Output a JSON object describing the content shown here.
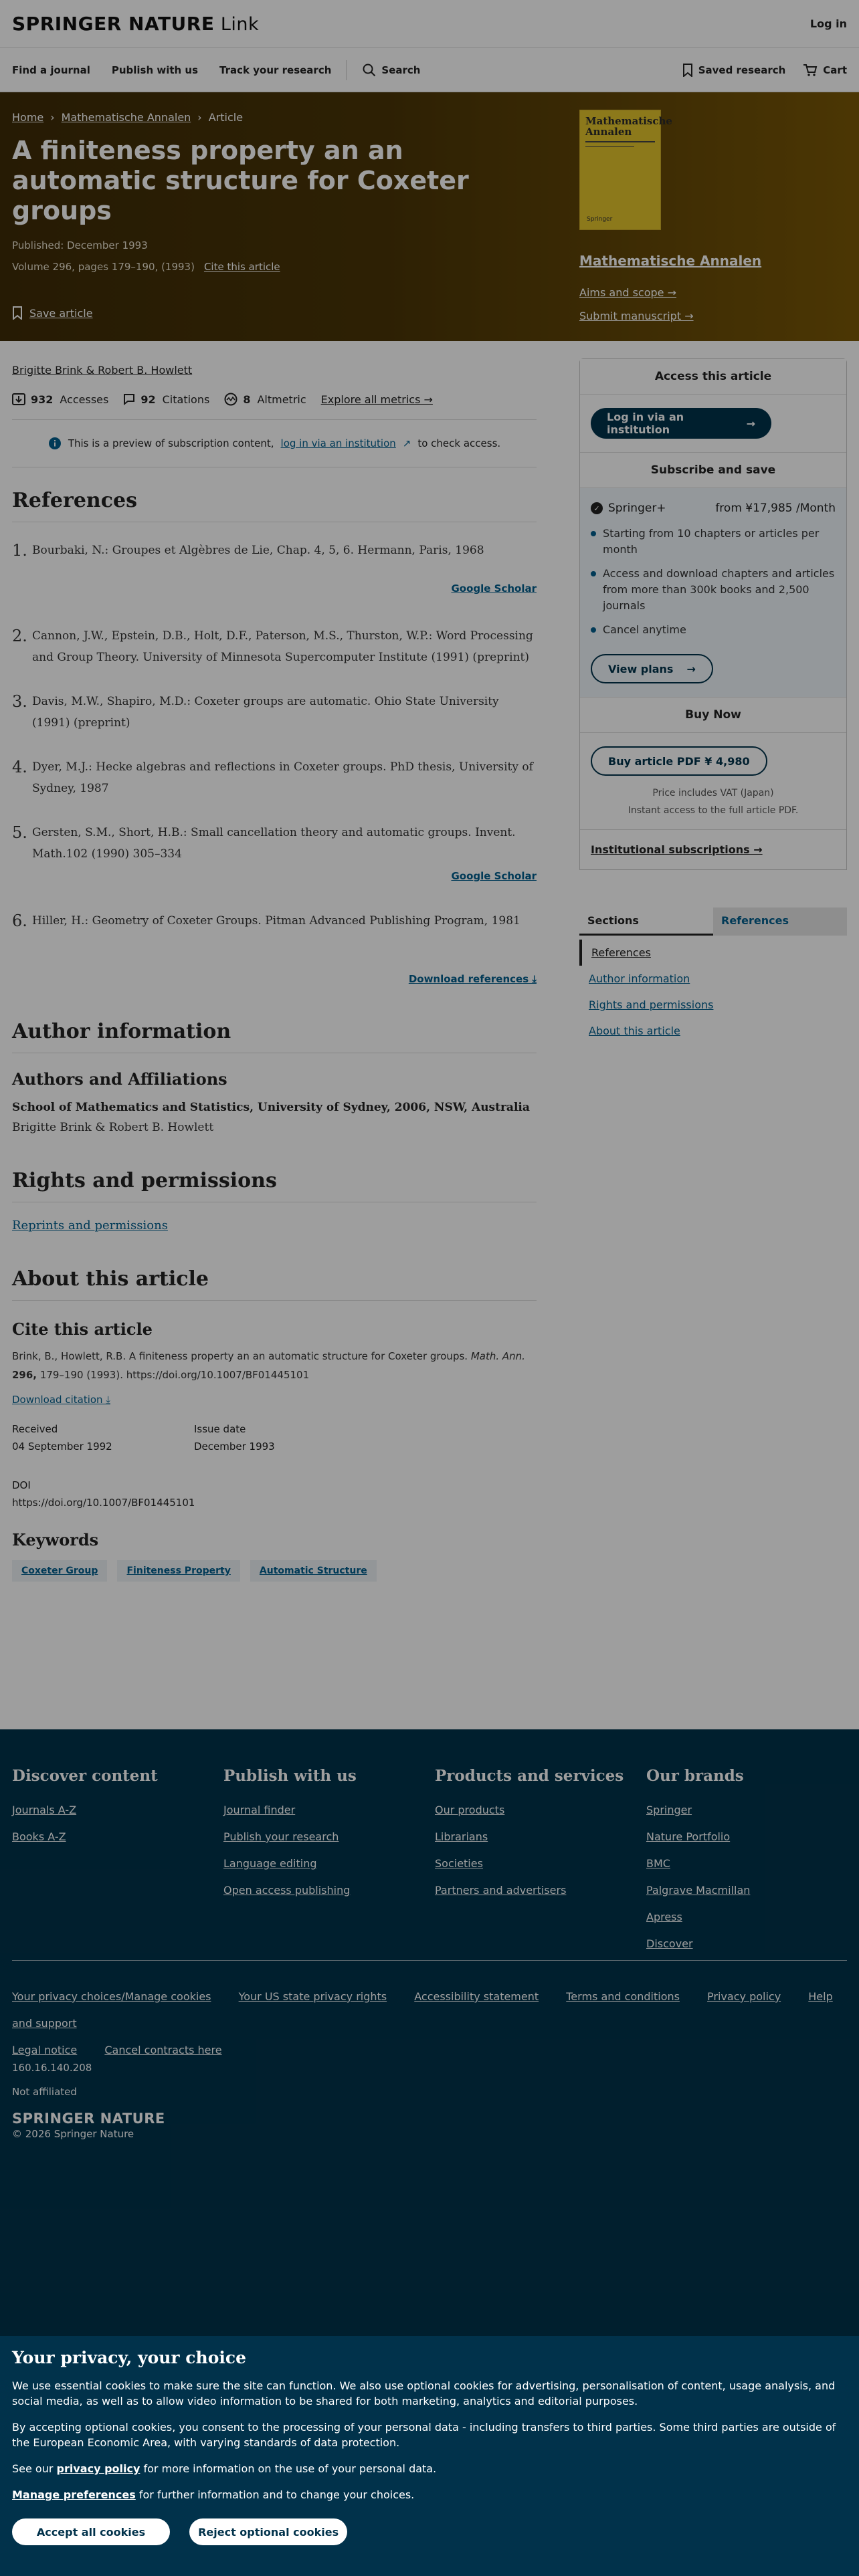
{
  "header": {
    "brand_a": "SPRINGER NATURE",
    "brand_b": "Link",
    "login": "Log in"
  },
  "nav": {
    "find_journal": "Find a journal",
    "publish": "Publish with us",
    "track": "Track your research",
    "search": "Search",
    "saved": "Saved research",
    "cart": "Cart"
  },
  "hero": {
    "crumbs": [
      "Home",
      "Mathematische Annalen",
      "Article"
    ],
    "title": "A finiteness property an an automatic structure for Coxeter groups",
    "published": "Published: December 1993",
    "volume": "Volume 296, pages 179–190, (1993)",
    "cite": "Cite this article",
    "save": "Save article",
    "journal_name": "Mathematische Annalen",
    "aims": "Aims and scope →",
    "submit": "Submit manuscript →",
    "cover_title": "Mathematische Annalen",
    "cover_publisher": "Springer"
  },
  "article": {
    "authors": "Brigitte Brink & Robert B. Howlett",
    "accesses_n": "932",
    "accesses_l": "Accesses",
    "citations_n": "92",
    "citations_l": "Citations",
    "altmetric_n": "8",
    "altmetric_l": "Altmetric",
    "explore": "Explore all metrics →",
    "notice_a": "This is a preview of subscription content,",
    "notice_link": "log in via an institution",
    "notice_b": "to check access."
  },
  "references": {
    "heading": "References",
    "items": [
      {
        "n": "1.",
        "text": "Bourbaki, N.: Groupes et Algèbres de Lie, Chap. 4, 5, 6. Hermann, Paris, 1968",
        "scholar": "Google Scholar"
      },
      {
        "n": "2.",
        "text": "Cannon, J.W., Epstein, D.B., Holt, D.F., Paterson, M.S., Thurston, W.P.: Word Processing and Group Theory. University of Minnesota Supercomputer Institute (1991) (preprint)"
      },
      {
        "n": "3.",
        "text": "Davis, M.W., Shapiro, M.D.: Coxeter groups are automatic. Ohio State University (1991) (preprint)"
      },
      {
        "n": "4.",
        "text": "Dyer, M.J.: Hecke algebras and reflections in Coxeter groups. PhD thesis, University of Sydney, 1987"
      },
      {
        "n": "5.",
        "text": "Gersten, S.M., Short, H.B.: Small cancellation theory and automatic groups. Invent. Math.102 (1990) 305–334",
        "scholar": "Google Scholar"
      },
      {
        "n": "6.",
        "text": "Hiller, H.: Geometry of Coxeter Groups. Pitman Advanced Publishing Program, 1981"
      }
    ],
    "download": "Download references ⤓"
  },
  "author_info": {
    "heading": "Author information",
    "sub": "Authors and Affiliations",
    "affiliation": "School of Mathematics and Statistics, University of Sydney, 2006, NSW, Australia",
    "names": "Brigitte Brink & Robert B. Howlett"
  },
  "rights": {
    "heading": "Rights and permissions",
    "link": "Reprints and permissions"
  },
  "about": {
    "heading": "About this article",
    "cite_heading": "Cite this article",
    "citation_a": "Brink, B., Howlett, R.B. A finiteness property an an automatic structure for Coxeter groups.",
    "citation_journal": "Math. Ann.",
    "citation_vol": "296,",
    "citation_b": "179–190 (1993). https://doi.org/10.1007/BF01445101",
    "download_citation": "Download citation ⤓",
    "received_l": "Received",
    "received_v": "04 September 1992",
    "issue_l": "Issue date",
    "issue_v": "December 1993",
    "doi_l": "DOI",
    "doi_v": "https://doi.org/10.1007/BF01445101",
    "keywords_heading": "Keywords",
    "keywords": [
      "Coxeter Group",
      "Finiteness Property",
      "Automatic Structure"
    ]
  },
  "sidebar": {
    "access": "Access this article",
    "login_inst": "Log in via an institution",
    "subscribe": "Subscribe and save",
    "plan": "Springer+",
    "price": "from ¥17,985 /Month",
    "bullets": [
      "Starting from 10 chapters or articles per month",
      "Access and download chapters and articles from more than 300k books and 2,500 journals",
      "Cancel anytime"
    ],
    "view_plans": "View plans",
    "buy_now": "Buy Now",
    "buy_pdf": "Buy article PDF ¥ 4,980",
    "vat": "Price includes VAT (Japan)",
    "instant": "Instant access to the full article PDF.",
    "inst_subs": "Institutional subscriptions →",
    "tab_sections": "Sections",
    "tab_references": "References",
    "sections": [
      "References",
      "Author information",
      "Rights and permissions",
      "About this article"
    ]
  },
  "footer": {
    "cols": [
      {
        "title": "Discover content",
        "links": [
          "Journals A-Z",
          "Books A-Z"
        ]
      },
      {
        "title": "Publish with us",
        "links": [
          "Journal finder",
          "Publish your research",
          "Language editing",
          "Open access publishing"
        ]
      },
      {
        "title": "Products and services",
        "links": [
          "Our products",
          "Librarians",
          "Societies",
          "Partners and advertisers"
        ]
      },
      {
        "title": "Our brands",
        "links": [
          "Springer",
          "Nature Portfolio",
          "BMC",
          "Palgrave Macmillan",
          "Apress",
          "Discover"
        ]
      }
    ],
    "legal": [
      "Your privacy choices/Manage cookies",
      "Your US state privacy rights",
      "Accessibility statement",
      "Terms and conditions",
      "Privacy policy",
      "Help and support",
      "Legal notice",
      "Cancel contracts here"
    ],
    "ip": "160.16.140.208",
    "affiliated": "Not affiliated",
    "brand": "SPRINGER NATURE",
    "copyright": "© 2026 Springer Nature"
  },
  "cookie": {
    "title": "Your privacy, your choice",
    "p1": "We use essential cookies to make sure the site can function. We also use optional cookies for advertising, personalisation of content, usage analysis, and social media, as well as to allow video information to be shared for both marketing, analytics and editorial purposes.",
    "p2": "By accepting optional cookies, you consent to the processing of your personal data - including transfers to third parties. Some third parties are outside of the European Economic Area, with varying standards of data protection.",
    "p3a": "See our",
    "p3link": "privacy policy",
    "p3b": "for more information on the use of your personal data.",
    "p4link": "Manage preferences",
    "p4b": "for further information and to change your choices.",
    "accept": "Accept all cookies",
    "reject": "Reject optional cookies"
  }
}
